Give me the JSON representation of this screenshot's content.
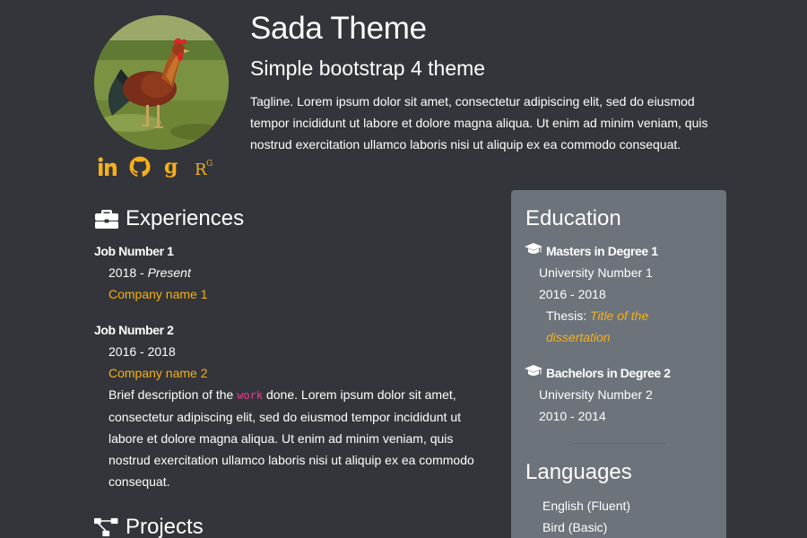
{
  "header": {
    "title": "Sada Theme",
    "subtitle": "Simple bootstrap 4 theme",
    "tagline": "Tagline. Lorem ipsum dolor sit amet, consectetur adipiscing elit, sed do eiusmod tempor incididunt ut labore et dolore magna aliqua. Ut enim ad minim veniam, quis nostrud exercitation ullamco laboris nisi ut aliquip ex ea commodo consequat."
  },
  "social": [
    {
      "icon": "linkedin-icon"
    },
    {
      "icon": "github-icon"
    },
    {
      "icon": "google-scholar-icon"
    },
    {
      "icon": "researchgate-icon",
      "text": "R",
      "sup": "G"
    }
  ],
  "experiences": {
    "heading": "Experiences",
    "icon": "briefcase-icon",
    "jobs": [
      {
        "title": "Job Number 1",
        "date_start": "2018 - ",
        "date_end": "Present",
        "company": "Company name 1"
      },
      {
        "title": "Job Number 2",
        "dates": "2016 - 2018",
        "company": "Company name 2",
        "desc_before": "Brief description of the ",
        "desc_code": "work",
        "desc_after": " done. Lorem ipsum dolor sit amet, consectetur adipiscing elit, sed do eiusmod tempor incididunt ut labore et dolore magna aliqua. Ut enim ad minim veniam, quis nostrud exercitation ullamco laboris nisi ut aliquip ex ea commodo consequat."
      }
    ]
  },
  "projects": {
    "heading": "Projects",
    "icon": "project-diagram-icon"
  },
  "education": {
    "heading": "Education",
    "icon": "graduation-cap-icon",
    "degrees": [
      {
        "title": "Masters in Degree 1",
        "university": "University Number 1",
        "dates": "2016 - 2018",
        "thesis_label": "Thesis: ",
        "thesis_title": "Title of the dissertation"
      },
      {
        "title": "Bachelors in Degree 2",
        "university": "University Number 2",
        "dates": "2010 - 2014"
      }
    ]
  },
  "languages": {
    "heading": "Languages",
    "items": [
      "English (Fluent)",
      "Bird (Basic)"
    ]
  },
  "colors": {
    "background": "#33353a",
    "sidebar": "#6c737b",
    "accent": "#f5b01a",
    "code": "#e83e8c"
  }
}
